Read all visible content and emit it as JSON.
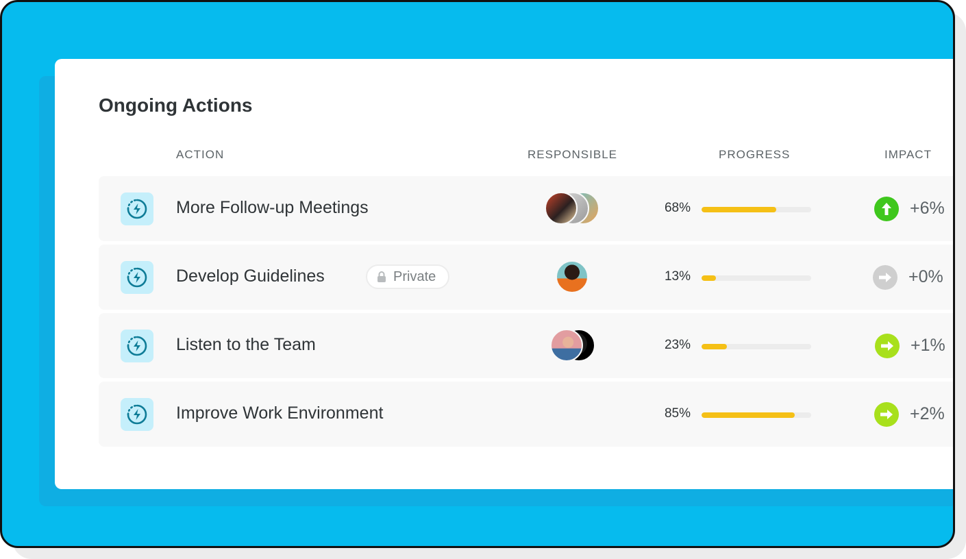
{
  "title": "Ongoing Actions",
  "columns": {
    "action": "ACTION",
    "responsible": "RESPONSIBLE",
    "progress": "PROGRESS",
    "impact": "IMPACT"
  },
  "badge": {
    "private_label": "Private"
  },
  "colors": {
    "frame": "#06bbee",
    "progress_fill": "#f5c016",
    "impact_up": "#3fc71d",
    "impact_neutral": "#cfcfcf",
    "impact_right": "#a8e01c",
    "icon_bg": "#c5effb",
    "icon_fg": "#0e7c97"
  },
  "rows": [
    {
      "label": "More Follow-up Meetings",
      "private": false,
      "responsible_count": 3,
      "progress_text": "68%",
      "progress": 0.68,
      "impact_icon": "arrow-up-icon",
      "impact": "+6%"
    },
    {
      "label": "Develop Guidelines",
      "private": true,
      "responsible_count": 1,
      "progress_text": "13%",
      "progress": 0.13,
      "impact_icon": "arrow-right-icon",
      "impact": "+0%"
    },
    {
      "label": "Listen to the Team",
      "private": false,
      "responsible_count": 2,
      "progress_text": "23%",
      "progress": 0.23,
      "impact_icon": "arrow-right-icon",
      "impact": "+1%"
    },
    {
      "label": "Improve Work Environment",
      "private": false,
      "responsible_count": 0,
      "progress_text": "85%",
      "progress": 0.85,
      "impact_icon": "arrow-right-icon",
      "impact": "+2%"
    }
  ]
}
